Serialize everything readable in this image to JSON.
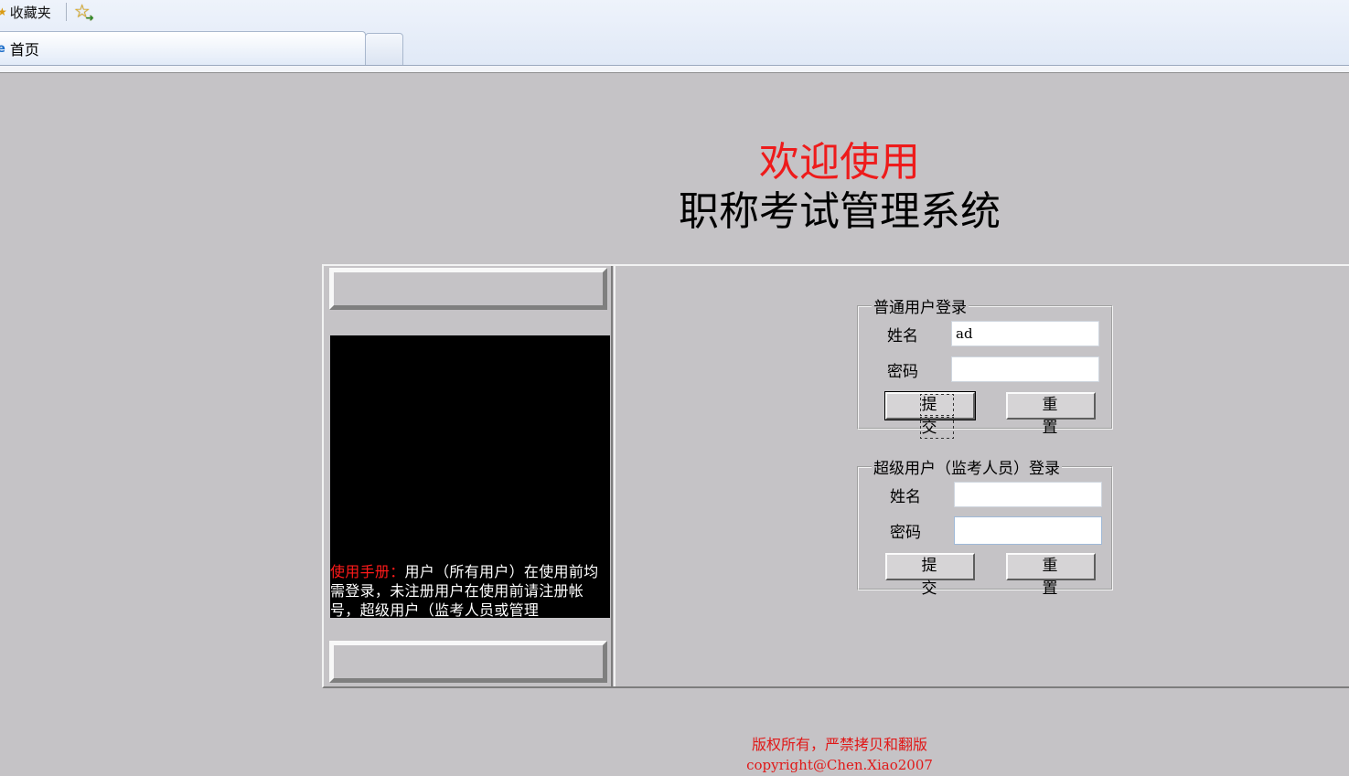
{
  "browser": {
    "favorites_label": "收藏夹",
    "tab_title": "首页"
  },
  "page": {
    "welcome": "欢迎使用",
    "system_title": "职称考试管理系统"
  },
  "manual": {
    "title": "使用手册：",
    "body": "用户（所有用户）在使用前均需登录，未注册用户在使用前请注册帐号，超级用户（监考人员或管理"
  },
  "normal_login": {
    "legend": "普通用户登录",
    "name_label": "姓名",
    "name_value": "ad",
    "password_label": "密码",
    "password_value": "",
    "submit_label": "提 交",
    "reset_label": "重 置"
  },
  "super_login": {
    "legend": "超级用户（监考人员）登录",
    "name_label": "姓名",
    "name_value": "",
    "password_label": "密码",
    "password_value": "",
    "submit_label": "提 交",
    "reset_label": "重 置"
  },
  "footer": {
    "line1": "版权所有，严禁拷贝和翻版",
    "line2": "copyright@Chen.Xiao2007"
  },
  "colors": {
    "page_bg": "#c5c3c6",
    "accent_red": "#ee1b1b"
  }
}
